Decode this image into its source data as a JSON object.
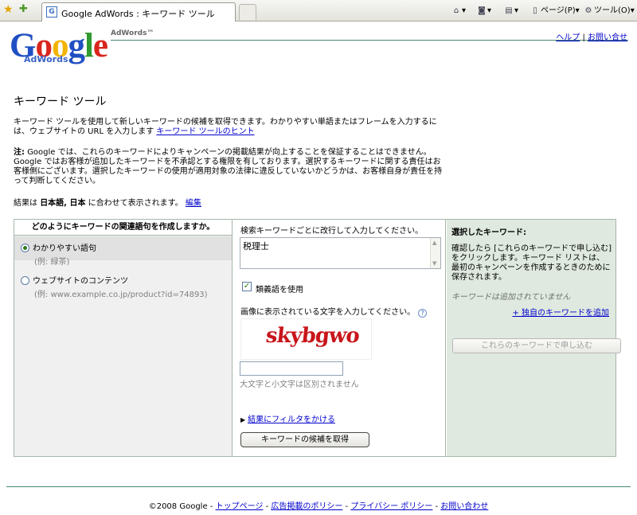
{
  "browser": {
    "tab_title": "Google AdWords : キーワード ツール",
    "favicon_letter": "G",
    "commands": {
      "page": "ページ(P)",
      "tools": "ツール(O)"
    }
  },
  "header": {
    "logo_google": "Google",
    "logo_sub": "AdWords",
    "adwords_tm": "AdWords™",
    "help_link": "ヘルプ",
    "separator": " | ",
    "contact_link": "お問い合せ"
  },
  "main": {
    "title": "キーワード ツール",
    "intro_text": "キーワード ツールを使用して新しいキーワードの候補を取得できます。わかりやすい単語またはフレームを入力するには、ウェブサイトの URL を入力します",
    "intro_link": "キーワード ツールのヒント",
    "note_label": "注:",
    "note_text": "Google では、これらのキーワードによりキャンペーンの掲載結果が向上することを保証することはできません。Google ではお客様が追加したキーワードを不承認とする権限を有しております。選択するキーワードに関する責任はお客様側にございます。選択したキーワードの使用が適用対象の法律に違反していないかどうかは、お客様自身が責任を持って判断してください。",
    "results_prefix": "結果は",
    "results_lang": "日本語, 日本",
    "results_suffix": "に合わせて表示されます。",
    "results_edit": "編集"
  },
  "panel": {
    "col1_heading": "どのようにキーワードの関連語句を作成しますか。",
    "option1_label": "わかりやすい語句",
    "option1_example": "(例: 緑茶)",
    "option2_label": "ウェブサイトのコンテンツ",
    "option2_example": "(例: www.example.co.jp/product?id=74893)",
    "col2_instruction": "検索キーワードごとに改行して入力してください。",
    "keyword_value": "税理士",
    "synonyms_label": "類義語を使用",
    "captcha_prompt": "画像に表示されている文字を入力してください。",
    "captcha_text": "skybgwo",
    "captcha_input_value": "",
    "case_note": "大文字と小文字は区別されません",
    "filter_link": "結果にフィルタをかける",
    "get_button": "キーワードの候補を取得",
    "col3_heading": "選択したキーワード:",
    "col3_desc": "確認したら [これらのキーワードで申し込む] をクリックします。キーワード リストは、最初のキャンペーンを作成するときのために保存されます。",
    "col3_empty": "キーワードは追加されていません",
    "col3_add_link": "+ 独自のキーワードを追加",
    "submit_button": "これらのキーワードで申し込む"
  },
  "footer": {
    "copyright": "©2008 Google",
    "dash": " - ",
    "top_page": "トップページ",
    "ad_policy": "広告掲載のポリシー",
    "privacy": "プライバシー ポリシー",
    "contact": "お問い合わせ"
  },
  "colors": {
    "link": "#0000cc",
    "divider_green": "#4a8a71",
    "selected_panel": "#dfe9df",
    "captcha_red": "#c8151a"
  }
}
